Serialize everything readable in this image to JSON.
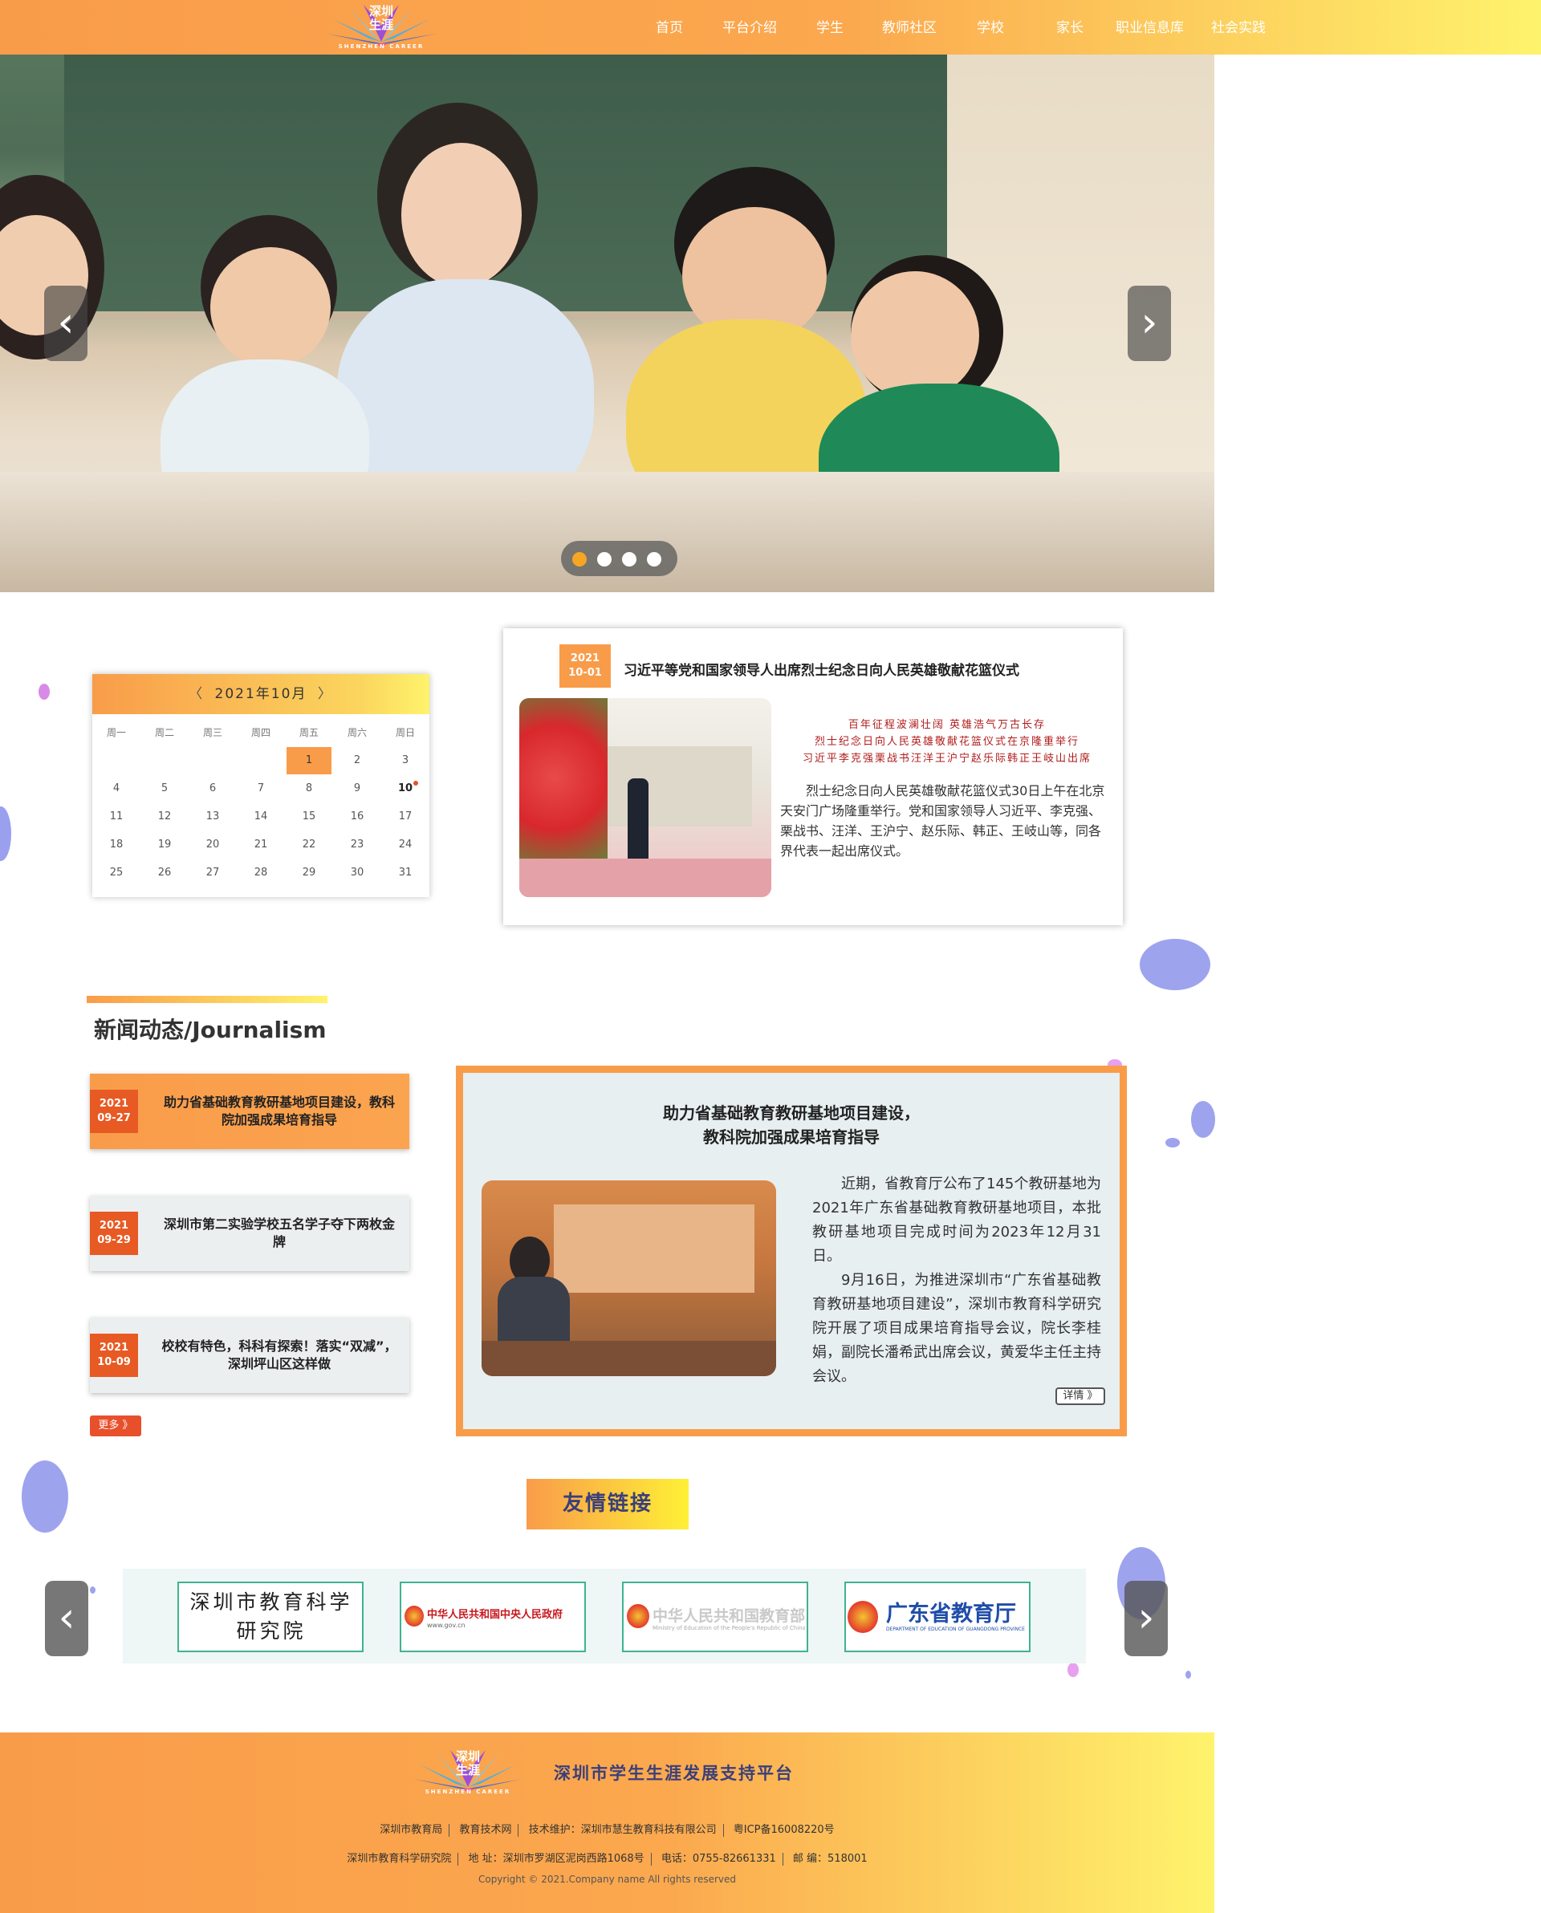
{
  "header": {
    "logo_cn": "深圳\n生涯",
    "logo_en": "SHENZHEN CAREER",
    "nav": [
      "首页",
      "平台介绍",
      "学生",
      "教师社区",
      "学校",
      "家长",
      "职业信息库",
      "社会实践"
    ]
  },
  "hero": {
    "prev_icon": "‹",
    "next_icon": "›",
    "slides": 4,
    "active_slide": 1
  },
  "calendar": {
    "title": "2021年10月",
    "prev_icon": "〈",
    "next_icon": "〉",
    "weekdays": [
      "周一",
      "周二",
      "周三",
      "周四",
      "周五",
      "周六",
      "周日"
    ],
    "selected_day": "1",
    "today": "10",
    "days": [
      [
        "",
        "",
        "",
        "",
        "1",
        "2",
        "3"
      ],
      [
        "4",
        "5",
        "6",
        "7",
        "8",
        "9",
        "10"
      ],
      [
        "11",
        "12",
        "13",
        "14",
        "15",
        "16",
        "17"
      ],
      [
        "18",
        "19",
        "20",
        "21",
        "22",
        "23",
        "24"
      ],
      [
        "25",
        "26",
        "27",
        "28",
        "29",
        "30",
        "31"
      ]
    ]
  },
  "featured": {
    "year": "2021",
    "date": "10-01",
    "title": "习近平等党和国家领导人出席烈士纪念日向人民英雄敬献花篮仪式",
    "poem": [
      "百年征程波澜壮阔 英雄浩气万古长存",
      "烈士纪念日向人民英雄敬献花篮仪式在京隆重举行",
      "习近平李克强栗战书汪洋王沪宁赵乐际韩正王岐山出席"
    ],
    "text": "烈士纪念日向人民英雄敬献花篮仪式30日上午在北京天安门广场隆重举行。党和国家领导人习近平、李克强、栗战书、汪洋、王沪宁、赵乐际、韩正、王岐山等，同各界代表一起出席仪式。"
  },
  "news": {
    "section_title": "新闻动态/Journalism",
    "items": [
      {
        "year": "2021",
        "date": "09-27",
        "title": "助力省基础教育教研基地项目建设，教科院加强成果培育指导"
      },
      {
        "year": "2021",
        "date": "09-29",
        "title": "深圳市第二实验学校五名学子夺下两枚金牌"
      },
      {
        "year": "2021",
        "date": "10-09",
        "title": "校校有特色，科科有探索！落实“双减”，深圳坪山区这样做"
      }
    ],
    "more_label": "更多 》",
    "detail": {
      "title_line1": "助力省基础教育教研基地项目建设，",
      "title_line2": "教科院加强成果培育指导",
      "para1": "近期，省教育厅公布了145个教研基地为2021年广东省基础教育教研基地项目，本批教研基地项目完成时间为2023年12月31日。",
      "para2": "9月16日，为推进深圳市“广东省基础教育教研基地项目建设”，深圳市教育科学研究院开展了项目成果培育指导会议，院长李桂娟，副院长潘希武出席会议，黄爱华主任主持会议。",
      "detail_label": "详情 》"
    }
  },
  "links": {
    "title": "友情链接",
    "prev_icon": "‹",
    "next_icon": "›",
    "cards": [
      {
        "name": "深圳市教育科学研究院"
      },
      {
        "name": "中华人民共和国中央人民政府",
        "sub": "www.gov.cn"
      },
      {
        "name": "中华人民共和国教育部",
        "sub": "Ministry of Education of the People's Republic of China"
      },
      {
        "name": "广东省教育厅",
        "sub": "DEPARTMENT OF EDUCATION OF GUANGDONG PROVINCE"
      }
    ]
  },
  "footer": {
    "logo_cn": "深圳\n生涯",
    "logo_en": "SHENZHEN CAREER",
    "title": "深圳市学生生涯发展支持平台",
    "line1": [
      "深圳市教育局",
      "教育技术网",
      "技术维护：深圳市慧生教育科技有限公司",
      "粤ICP备16008220号"
    ],
    "line2": [
      "深圳市教育科学研究院",
      "地 址：深圳市罗湖区泥岗西路1068号",
      "电话：0755-82661331",
      "邮 编：518001"
    ],
    "copyright": "Copyright © 2021.Company name All rights reserved"
  },
  "colors": {
    "accent_orange": "#f99c4a",
    "accent_yellow": "#fef36c",
    "accent_red": "#e8502c",
    "title_navy": "#3a3f7a"
  }
}
